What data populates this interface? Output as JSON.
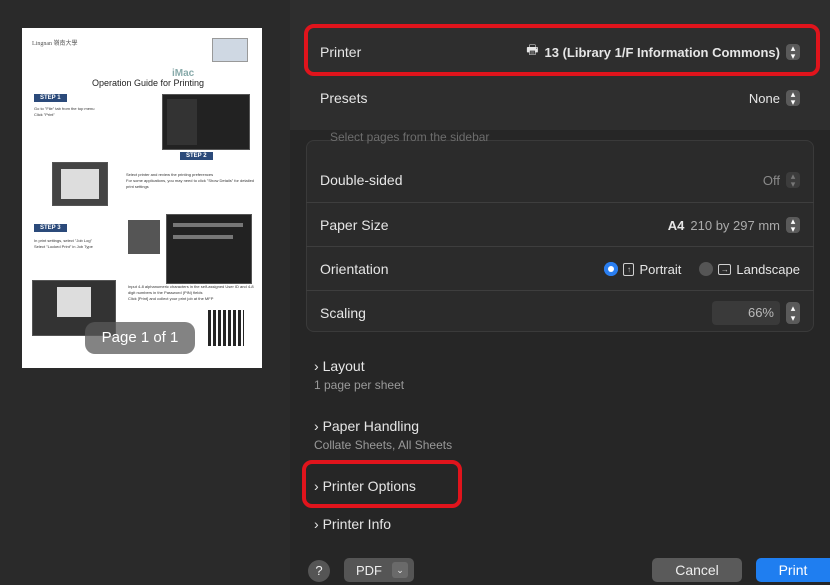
{
  "preview": {
    "page_indicator": "Page 1 of 1",
    "document": {
      "org": "Lingnan 嶺南大學",
      "brand": "iMac",
      "title": "Operation Guide for Printing",
      "step1": "STEP 1",
      "step1_lines": [
        "Go to \"File\" tab from the top menu",
        "Click \"Print\""
      ],
      "step2": "STEP 2",
      "step2_lines": [
        "Select printer and review the printing preferences",
        "For some applications, you may need to click \"Show Details\" for detailed print settings"
      ],
      "step3": "STEP 3",
      "step3_lines": [
        "In print settings, select \"Job Log\"",
        "Select \"Locked Print\" in Job Type"
      ],
      "step4_lines": [
        "Input 4-8 alphanumeric characters in the self-assigned User ID and 4-8 digit numbers in the Password (PIN) fields",
        "Click [Print] and collect your print job at the MFP"
      ]
    }
  },
  "settings": {
    "printer": {
      "label": "Printer",
      "value": "13 (Library 1/F Information Commons)",
      "icon": "printer-icon"
    },
    "presets": {
      "label": "Presets",
      "value": "None"
    },
    "faded_hint": "Select pages from the sidebar",
    "double_sided": {
      "label": "Double-sided",
      "value": "Off"
    },
    "paper_size": {
      "label": "Paper Size",
      "value": "A4",
      "detail": "210 by 297 mm"
    },
    "orientation": {
      "label": "Orientation",
      "portrait": "Portrait",
      "landscape": "Landscape",
      "selected": "Portrait"
    },
    "scaling": {
      "label": "Scaling",
      "value": "66%"
    }
  },
  "sections": [
    {
      "title": "Layout",
      "subtitle": "1 page per sheet"
    },
    {
      "title": "Paper Handling",
      "subtitle": "Collate Sheets, All Sheets"
    },
    {
      "title": "Printer Options",
      "subtitle": ""
    },
    {
      "title": "Printer Info",
      "subtitle": ""
    }
  ],
  "footer": {
    "help": "?",
    "pdf": "PDF",
    "cancel": "Cancel",
    "print": "Print"
  },
  "colors": {
    "accent": "#1f7ef0",
    "highlight": "#e0141c"
  }
}
